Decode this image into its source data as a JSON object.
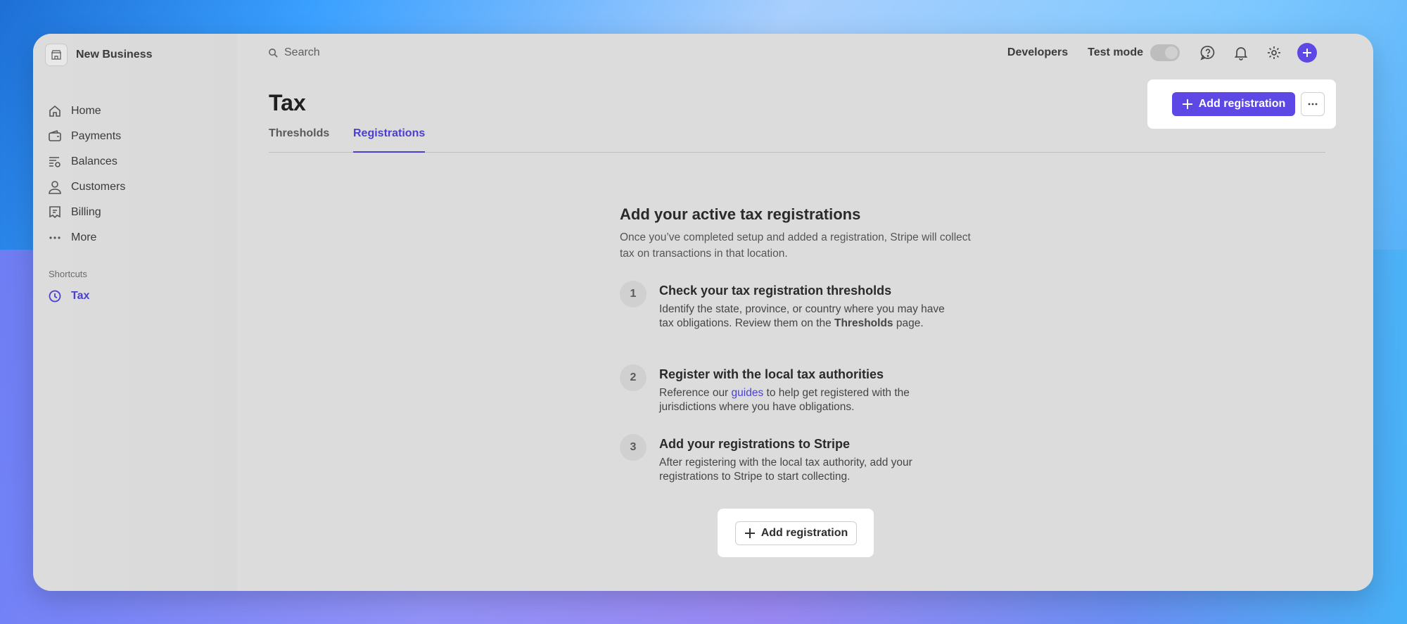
{
  "business": {
    "name": "New Business"
  },
  "sidebar": {
    "items": [
      {
        "label": "Home",
        "icon": "home-icon"
      },
      {
        "label": "Payments",
        "icon": "wallet-icon"
      },
      {
        "label": "Balances",
        "icon": "balances-icon"
      },
      {
        "label": "Customers",
        "icon": "person-icon"
      },
      {
        "label": "Billing",
        "icon": "billing-icon"
      },
      {
        "label": "More",
        "icon": "ellipsis-icon"
      }
    ],
    "shortcuts_label": "Shortcuts",
    "shortcut": {
      "label": "Tax",
      "icon": "clock-icon"
    }
  },
  "topbar": {
    "search_placeholder": "Search",
    "developers": "Developers",
    "test_mode": "Test mode",
    "test_mode_on": false
  },
  "page": {
    "title": "Tax",
    "tabs": [
      {
        "label": "Thresholds",
        "active": false
      },
      {
        "label": "Registrations",
        "active": true
      }
    ],
    "add_registration": "Add registration",
    "more": "···"
  },
  "content": {
    "heading": "Add your active tax registrations",
    "intro": "Once you’ve completed setup and added a registration, Stripe will collect tax on transactions in that location.",
    "steps": [
      {
        "num": "1",
        "title": "Check your tax registration thresholds",
        "text_before": "Identify the state, province, or country where you may have tax obligations. Review them on the ",
        "bold": "Thresholds",
        "text_after": " page."
      },
      {
        "num": "2",
        "title": "Register with the local tax authorities",
        "text_before": "Reference our ",
        "link": "guides",
        "text_after": " to help get registered with the jurisdictions where you have obligations."
      },
      {
        "num": "3",
        "title": "Add your registrations to Stripe",
        "text": "After registering with the local tax authority, add your registrations to Stripe to start collecting."
      }
    ],
    "button": "Add registration"
  },
  "colors": {
    "accent": "#5d48e6",
    "link": "#4b3fcf"
  }
}
